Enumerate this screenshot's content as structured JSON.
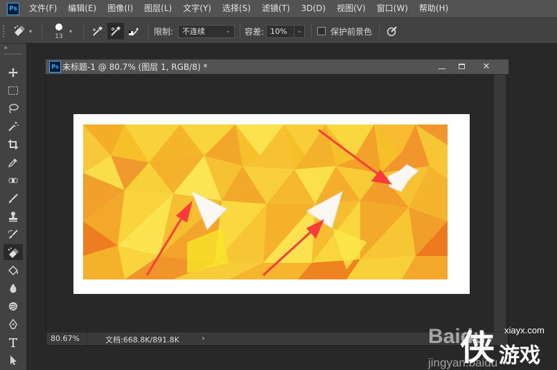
{
  "app": {
    "logo": "Ps"
  },
  "menu": [
    "文件(F)",
    "编辑(E)",
    "图像(I)",
    "图层(L)",
    "文字(Y)",
    "选择(S)",
    "滤镜(T)",
    "3D(D)",
    "视图(V)",
    "窗口(W)",
    "帮助(H)"
  ],
  "options": {
    "brush_size": "13",
    "limit_label": "限制:",
    "limit_value": "不连续",
    "tolerance_label": "容差:",
    "tolerance_value": "10%",
    "protect_foreground_label": "保护前景色",
    "protect_foreground_checked": false
  },
  "toolbar": {
    "collapse_glyph": "»",
    "tools": [
      "move-icon",
      "marquee-icon",
      "lasso-icon",
      "magic-wand-icon",
      "crop-icon",
      "eyedropper-icon",
      "healing-brush-icon",
      "brush-icon",
      "clone-stamp-icon",
      "history-brush-icon",
      "background-eraser-icon",
      "paint-bucket-icon",
      "blur-icon",
      "dodge-icon",
      "pen-icon",
      "type-icon",
      "path-select-icon"
    ],
    "active_tool": "background-eraser-icon"
  },
  "document": {
    "title": "未标题-1 @ 80.7% (图层 1, RGB/8) *",
    "zoom": "80.67%",
    "doc_size": "文档:668.8K/891.8K",
    "status_arrow": "›"
  },
  "colors": {
    "arrow": "#ff3b3b",
    "canvas_bg": "#ffffff",
    "workspace": "#282828"
  },
  "watermark": {
    "brand": "Baidu",
    "url": "jingyan.baidu",
    "site": "xiayx.com",
    "char": "侠",
    "game": "游戏"
  }
}
